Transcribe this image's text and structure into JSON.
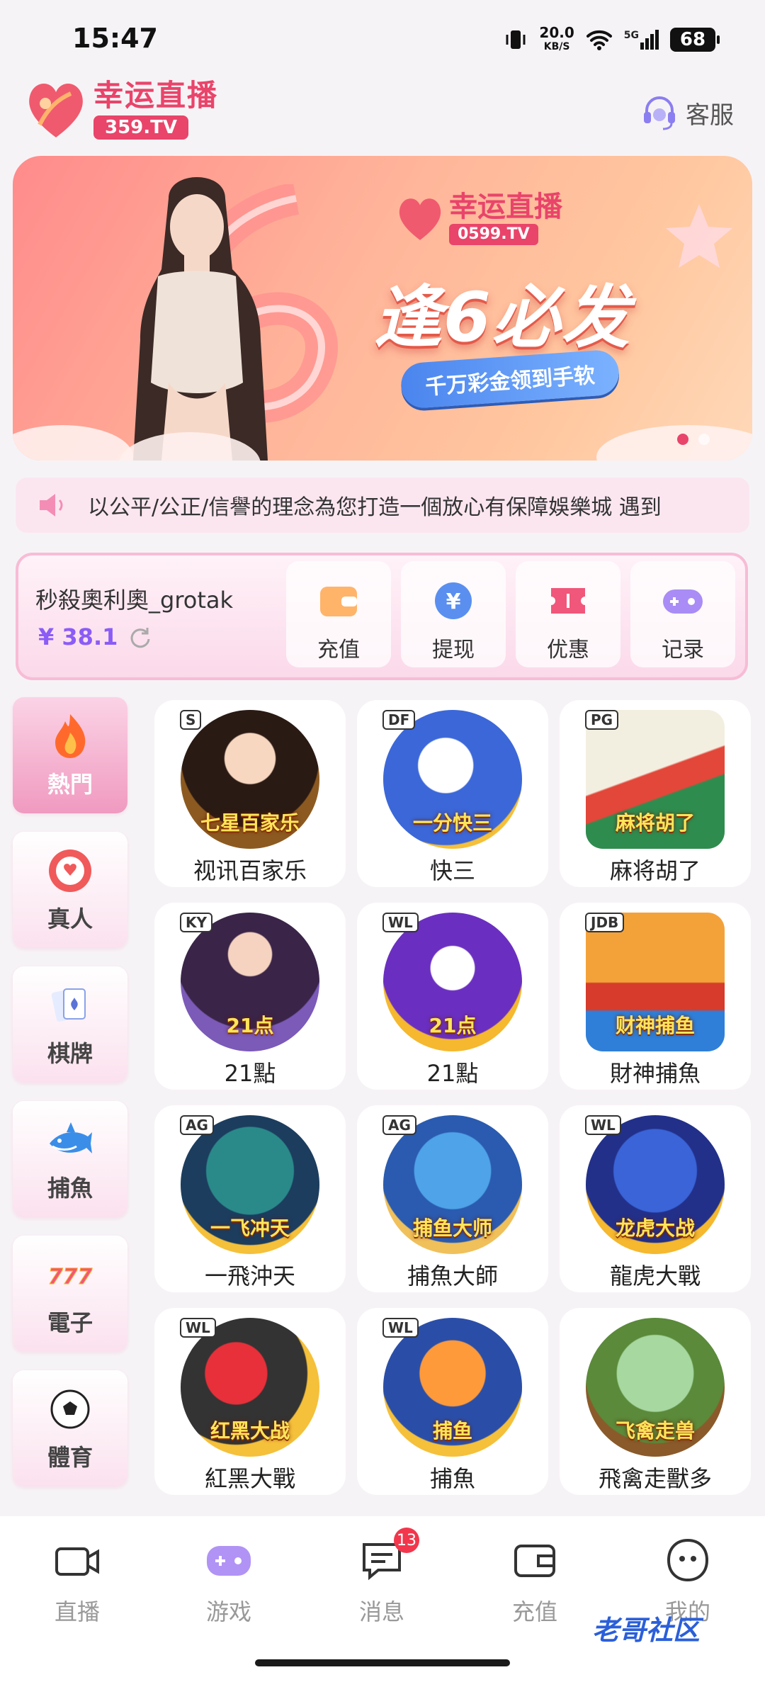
{
  "status_bar": {
    "time": "15:47",
    "net_speed": "20.0",
    "net_unit": "KB/S",
    "signal": "5G",
    "battery": "68"
  },
  "header": {
    "brand_title": "幸运直播",
    "brand_sub": "359.TV",
    "service_label": "客服"
  },
  "banner": {
    "brand_title": "幸运直播",
    "brand_sub": "0599.TV",
    "headline": "逢6必发",
    "pill": "千万彩金领到手软"
  },
  "marquee": {
    "text": "以公平/公正/信譽的理念為您打造一個放心有保障娛樂城   遇到"
  },
  "account": {
    "username": "秒殺奧利奧_grotak",
    "balance": "¥ 38.1",
    "actions": [
      {
        "label": "充值"
      },
      {
        "label": "提现"
      },
      {
        "label": "优惠"
      },
      {
        "label": "记录"
      }
    ]
  },
  "categories": [
    {
      "label": "熱門"
    },
    {
      "label": "真人"
    },
    {
      "label": "棋牌"
    },
    {
      "label": "捕魚"
    },
    {
      "label": "電子"
    },
    {
      "label": "體育"
    }
  ],
  "games": [
    {
      "label": "视讯百家乐",
      "thumb_text": "七星百家乐",
      "badge": "S"
    },
    {
      "label": "快三",
      "thumb_text": "一分快三",
      "badge": "DF"
    },
    {
      "label": "麻将胡了",
      "thumb_text": "麻将胡了",
      "badge": "PG"
    },
    {
      "label": "21點",
      "thumb_text": "21点",
      "badge": "KY"
    },
    {
      "label": "21點",
      "thumb_text": "21点",
      "badge": "WL"
    },
    {
      "label": "財神捕魚",
      "thumb_text": "财神捕鱼",
      "badge": "JDB"
    },
    {
      "label": "一飛沖天",
      "thumb_text": "一飞冲天",
      "badge": "AG"
    },
    {
      "label": "捕魚大師",
      "thumb_text": "捕鱼大师",
      "badge": "AG"
    },
    {
      "label": "龍虎大戰",
      "thumb_text": "龙虎大战",
      "badge": "WL"
    },
    {
      "label": "紅黑大戰",
      "thumb_text": "红黑大战",
      "badge": "WL"
    },
    {
      "label": "捕魚",
      "thumb_text": "捕鱼",
      "badge": "WL"
    },
    {
      "label": "飛禽走獸多",
      "thumb_text": "飞禽走兽",
      "badge": ""
    }
  ],
  "bottom_nav": [
    {
      "label": "直播"
    },
    {
      "label": "游戏"
    },
    {
      "label": "消息",
      "badge": "13"
    },
    {
      "label": "充值"
    },
    {
      "label": "我的"
    }
  ],
  "watermark": "老哥社区",
  "colors": {
    "brand": "#e9446a",
    "accent": "#8b5cf6",
    "bg": "#f6f3f6"
  }
}
